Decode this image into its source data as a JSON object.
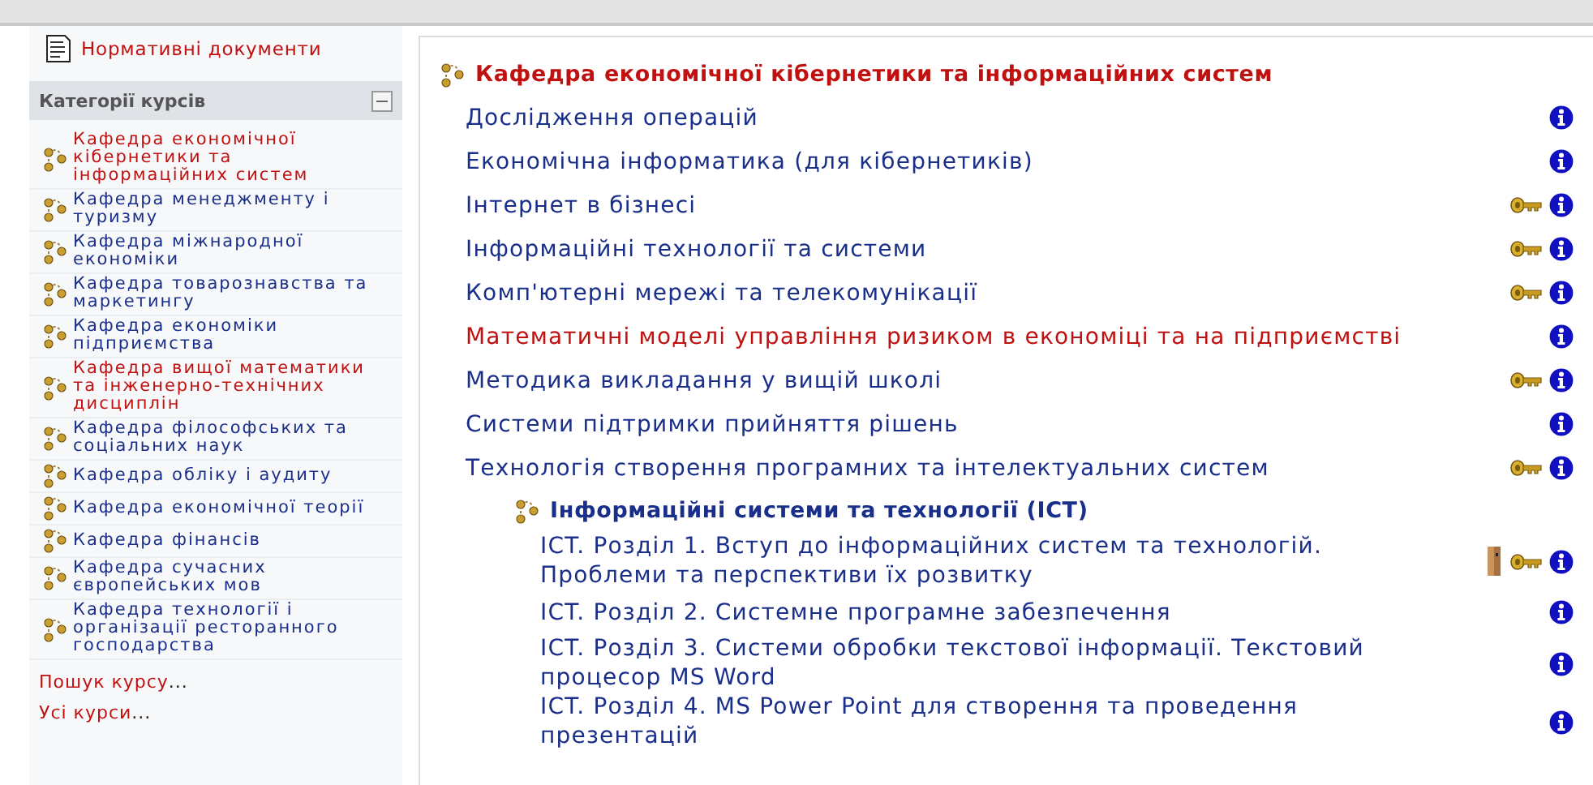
{
  "sidebar": {
    "documents_link": "Нормативні документи",
    "block_title": "Категорії курсів",
    "categories": [
      {
        "label": "Кафедра економічної кібернетики та інформаційних систем",
        "highlighted": true
      },
      {
        "label": "Кафедра менеджменту і туризму",
        "highlighted": false
      },
      {
        "label": "Кафедра міжнародної економіки",
        "highlighted": false
      },
      {
        "label": "Кафедра товарознавства та маркетингу",
        "highlighted": false
      },
      {
        "label": "Кафедра економіки підприємства",
        "highlighted": false
      },
      {
        "label": "Кафедра вищої математики та інженерно-технічних дисциплін",
        "highlighted": true
      },
      {
        "label": "Кафедра філософських та соціальних наук",
        "highlighted": false
      },
      {
        "label": "Кафедра обліку і аудиту",
        "highlighted": false
      },
      {
        "label": "Кафедра економічної теорії",
        "highlighted": false
      },
      {
        "label": "Кафедра фінансів",
        "highlighted": false
      },
      {
        "label": "Кафедра сучасних європейських мов",
        "highlighted": false
      },
      {
        "label": "Кафедра технології і організації ресторанного господарства",
        "highlighted": false
      }
    ],
    "links": [
      {
        "label": "Пошук курсу",
        "suffix": "..."
      },
      {
        "label": "Усі курси",
        "suffix": "..."
      }
    ]
  },
  "main": {
    "category": "Кафедра економічної кібернетики та інформаційних систем",
    "courses": [
      {
        "title": "Дослідження операцій",
        "highlighted": false,
        "guest": false,
        "key": false
      },
      {
        "title": "Економічна інформатика (для кібернетиків)",
        "highlighted": false,
        "guest": false,
        "key": false
      },
      {
        "title": "Інтернет в бізнесі",
        "highlighted": false,
        "guest": false,
        "key": true
      },
      {
        "title": "Інформаційні технології та системи",
        "highlighted": false,
        "guest": false,
        "key": true
      },
      {
        "title": "Комп'ютерні мережі та телекомунікації",
        "highlighted": false,
        "guest": false,
        "key": true
      },
      {
        "title": "Математичні моделі управління ризиком в економіці та на підприємстві",
        "highlighted": true,
        "guest": false,
        "key": false
      },
      {
        "title": "Методика викладання у вищій школі",
        "highlighted": false,
        "guest": false,
        "key": true
      },
      {
        "title": "Системи підтримки прийняття рішень",
        "highlighted": false,
        "guest": false,
        "key": false
      },
      {
        "title": "Технологія створення програмних та інтелектуальних систем",
        "highlighted": false,
        "guest": false,
        "key": true
      }
    ],
    "subcategory": {
      "title": "Інформаційні системи та технології (ICT)",
      "courses": [
        {
          "title": "ICT. Розділ 1. Вступ до інформаційних систем та технологій. Проблеми та перспективи їх розвитку",
          "highlighted": false,
          "guest": true,
          "key": true
        },
        {
          "title": "ICT. Розділ 2. Системне програмне забезпечення",
          "highlighted": false,
          "guest": false,
          "key": false
        },
        {
          "title": "ICT. Розділ 3. Системи обробки текстової інформації. Текстовий процесор MS Word",
          "highlighted": false,
          "guest": false,
          "key": false
        },
        {
          "title": "ICT. Розділ 4. MS Power Point для створення та проведення презентацій",
          "highlighted": false,
          "guest": false,
          "key": false
        }
      ]
    }
  }
}
